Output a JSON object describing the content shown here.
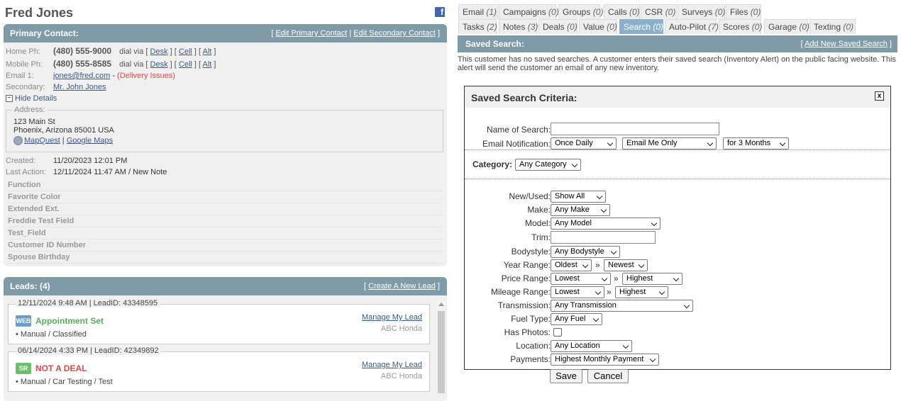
{
  "customer": {
    "name": "Fred Jones"
  },
  "icons": {
    "facebook": "facebook-icon",
    "globe": "globe-icon",
    "close": "close-icon"
  },
  "contact": {
    "header": "Primary Contact:",
    "header_links": {
      "open": "[",
      "edit_primary": "Edit Primary Contact",
      "sep": "|",
      "edit_secondary": "Edit Secondary Contact",
      "close": "]"
    },
    "home_label": "Home Ph:",
    "home_phone": "(480) 555-9000",
    "mobile_label": "Mobile Ph:",
    "mobile_phone": "(480) 555-8585",
    "dial_via": "dial via",
    "dial_desk": "Desk",
    "dial_cell": "Cell",
    "dial_alt": "Alt",
    "email_label": "Email 1:",
    "email": "jones@fred.com",
    "email_sep": " - ",
    "email_issue": "(Delivery Issues)",
    "secondary_label": "Secondary:",
    "secondary": "Mr. John Jones",
    "hide_details": "Hide Details",
    "address_legend": "Address:",
    "address_line1": "123 Main St",
    "address_line2": "Phoenix, Arizona 85001 USA",
    "mapquest": "MapQuest",
    "map_sep": " | ",
    "google_maps": "Google Maps",
    "created_label": "Created:",
    "created": "11/20/2023 12:01 PM",
    "last_action_label": "Last Action:",
    "last_action": "12/11/2024 11:47 AM / New Note",
    "custom_fields": [
      "Function",
      "Favorite Color",
      "Extended Ext.",
      "Freddie Test Field",
      "Test_Field",
      "Customer ID Number",
      "Spouse Birthday"
    ]
  },
  "leads": {
    "header": "Leads: (4)",
    "create_link": "Create A New Lead",
    "items": [
      {
        "meta": "12/11/2024 9:48 AM | LeadID: 43348595",
        "badge": "WEB",
        "badge_color": "#6d9ec7",
        "status": "Appointment Set",
        "status_color": "#5aab5a",
        "tags": "•   Manual  /  Classified",
        "manage": "Manage My Lead",
        "dealer": "ABC Honda"
      },
      {
        "meta": "06/14/2024 4:33 PM | LeadID: 42349892",
        "badge": "SR",
        "badge_color": "#6bbf6b",
        "status": "NOT A DEAL",
        "status_color": "#e04848",
        "tags": "•   Manual  / Car Testing  /  Test",
        "manage": "Manage My Lead",
        "dealer": "ABC Honda"
      }
    ]
  },
  "tabs": {
    "row1": [
      {
        "label": "Email",
        "count": "(1)"
      },
      {
        "label": "Campaigns",
        "count": "(0)"
      },
      {
        "label": "Groups",
        "count": "(0)"
      },
      {
        "label": "Calls",
        "count": "(0)"
      },
      {
        "label": "CSR",
        "count": "(0)"
      },
      {
        "label": "Surveys",
        "count": "(0)"
      },
      {
        "label": "Files",
        "count": "(0)"
      }
    ],
    "row2": [
      {
        "label": "Tasks",
        "count": "(2)"
      },
      {
        "label": "Notes",
        "count": "(3)"
      },
      {
        "label": "Deals",
        "count": "(0)"
      },
      {
        "label": "Value",
        "count": "(0)"
      },
      {
        "label": "Search",
        "count": "(0)",
        "active": true
      },
      {
        "label": "Auto-Pilot",
        "count": "(7)"
      },
      {
        "label": "Scores",
        "count": "(0)"
      },
      {
        "label": "Garage",
        "count": "(0)"
      },
      {
        "label": "Texting",
        "count": "(0)"
      }
    ]
  },
  "saved_search": {
    "header": "Saved Search:",
    "add_link": "Add New Saved Search",
    "notice": "This customer has no saved searches. A customer enters their saved search (Inventory Alert) on the public facing website. This alert will send the customer an email of any new inventory."
  },
  "criteria": {
    "title": "Saved Search Criteria:",
    "close": "x",
    "name_label": "Name of Search:",
    "name_value": "",
    "email_label": "Email Notification:",
    "email_freq": "Once Daily",
    "email_target": "Email Me Only",
    "email_duration": "for 3 Months",
    "category_label": "Category:",
    "category": "Any Category",
    "new_used_label": "New/Used:",
    "new_used": "Show All",
    "make_label": "Make:",
    "make": "Any Make",
    "model_label": "Model:",
    "model": "Any Model",
    "trim_label": "Trim:",
    "trim": "",
    "bodystyle_label": "Bodystyle:",
    "bodystyle": "Any Bodystyle",
    "year_label": "Year Range:",
    "year_from": "Oldest",
    "year_to": "Newest",
    "price_label": "Price Range:",
    "price_from": "Lowest",
    "price_to": "Highest",
    "mileage_label": "Mileage Range:",
    "mileage_from": "Lowest",
    "mileage_to": "Highest",
    "range_sep": "»",
    "transmission_label": "Transmission:",
    "transmission": "Any Transmission",
    "fuel_label": "Fuel Type:",
    "fuel": "Any Fuel",
    "photos_label": "Has Photos:",
    "location_label": "Location:",
    "location": "Any Location",
    "payments_label": "Payments:",
    "payments": "Highest Monthly Payment",
    "save": "Save",
    "cancel": "Cancel"
  }
}
